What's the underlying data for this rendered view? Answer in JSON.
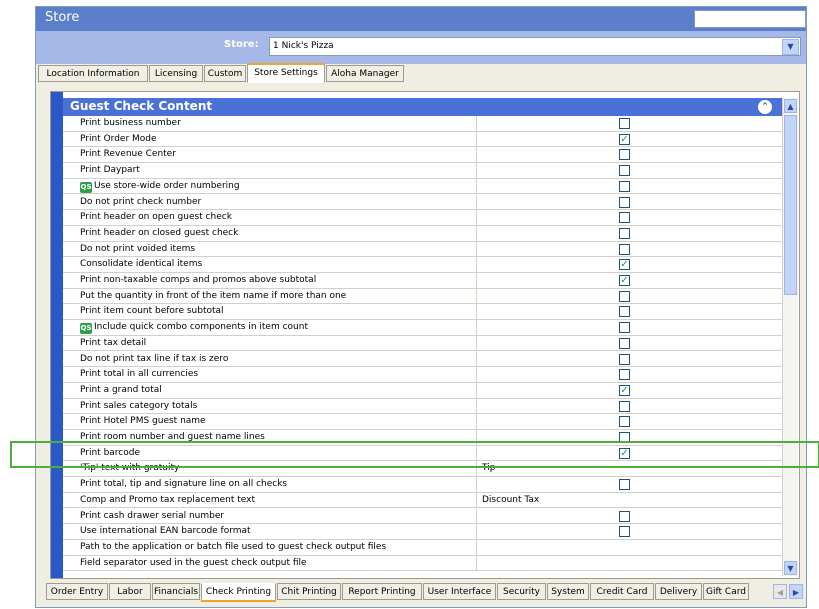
{
  "window": {
    "title": "Store"
  },
  "store": {
    "label": "Store:",
    "value": "1 Nick's Pizza"
  },
  "top_tabs": [
    {
      "label": "Location Information",
      "active": false
    },
    {
      "label": "Licensing",
      "active": false
    },
    {
      "label": "Custom",
      "active": false
    },
    {
      "label": "Store Settings",
      "active": true
    },
    {
      "label": "Aloha Manager",
      "active": false
    }
  ],
  "section": {
    "title": "Guest Check Content"
  },
  "rows": [
    {
      "label": "Print business number",
      "type": "check",
      "checked": false
    },
    {
      "label": "Print Order Mode",
      "type": "check",
      "checked": true
    },
    {
      "label": "Print Revenue Center",
      "type": "check",
      "checked": false
    },
    {
      "label": "Print Daypart",
      "type": "check",
      "checked": false
    },
    {
      "label": "Use store-wide order numbering",
      "type": "check",
      "checked": false,
      "qs": true
    },
    {
      "label": "Do not print check number",
      "type": "check",
      "checked": false
    },
    {
      "label": "Print header on open guest check",
      "type": "check",
      "checked": false
    },
    {
      "label": "Print header on closed guest check",
      "type": "check",
      "checked": false
    },
    {
      "label": "Do not print voided items",
      "type": "check",
      "checked": false
    },
    {
      "label": "Consolidate identical items",
      "type": "check",
      "checked": true
    },
    {
      "label": "Print non-taxable comps and promos above subtotal",
      "type": "check",
      "checked": true
    },
    {
      "label": "Put the quantity in front of the item name if more than one",
      "type": "check",
      "checked": false
    },
    {
      "label": "Print item count before subtotal",
      "type": "check",
      "checked": false
    },
    {
      "label": "Include quick combo components in item count",
      "type": "check",
      "checked": false,
      "qs": true
    },
    {
      "label": "Print tax detail",
      "type": "check",
      "checked": false
    },
    {
      "label": "Do not print tax line if tax is zero",
      "type": "check",
      "checked": false
    },
    {
      "label": "Print total in all currencies",
      "type": "check",
      "checked": false
    },
    {
      "label": "Print a grand total",
      "type": "check",
      "checked": true
    },
    {
      "label": "Print sales category totals",
      "type": "check",
      "checked": false
    },
    {
      "label": "Print Hotel PMS guest name",
      "type": "check",
      "checked": false
    },
    {
      "label": "Print room number and guest name lines",
      "type": "check",
      "checked": false
    },
    {
      "label": "Print barcode",
      "type": "check",
      "checked": true
    },
    {
      "label": "'Tip' text with gratuity",
      "type": "text",
      "value": "Tip"
    },
    {
      "label": "Print total, tip and signature  line on all checks",
      "type": "check",
      "checked": false
    },
    {
      "label": "Comp and Promo tax replacement text",
      "type": "text",
      "value": "Discount Tax"
    },
    {
      "label": "Print cash drawer serial number",
      "type": "check",
      "checked": false
    },
    {
      "label": "Use international EAN barcode format",
      "type": "check",
      "checked": false
    },
    {
      "label": "Path to the application or batch file used to guest check output files",
      "type": "text",
      "value": ""
    },
    {
      "label": "Field separator used in the guest check output file",
      "type": "text",
      "value": ""
    }
  ],
  "qs_badge": "QS",
  "bottom_tabs": [
    {
      "label": "Order Entry",
      "active": false
    },
    {
      "label": "Labor",
      "active": false
    },
    {
      "label": "Financials",
      "active": false
    },
    {
      "label": "Check Printing",
      "active": true
    },
    {
      "label": "Chit Printing",
      "active": false
    },
    {
      "label": "Report Printing",
      "active": false
    },
    {
      "label": "User Interface",
      "active": false
    },
    {
      "label": "Security",
      "active": false
    },
    {
      "label": "System",
      "active": false
    },
    {
      "label": "Credit Card",
      "active": false
    },
    {
      "label": "Delivery",
      "active": false
    },
    {
      "label": "Gift Card",
      "active": false
    }
  ],
  "icons": {
    "dropdown": "chevron-down-icon",
    "collapse": "double-chevron-up-icon",
    "scroll_up": "scroll-up-icon",
    "scroll_down": "scroll-down-icon",
    "tabs_left": "chevron-left-icon",
    "tabs_right": "chevron-right-icon"
  },
  "colors": {
    "title_bar": "#5b7fcb",
    "section_header": "#4a71d6",
    "highlight": "#4cae3d",
    "active_tab_accent": "#f0a628"
  }
}
